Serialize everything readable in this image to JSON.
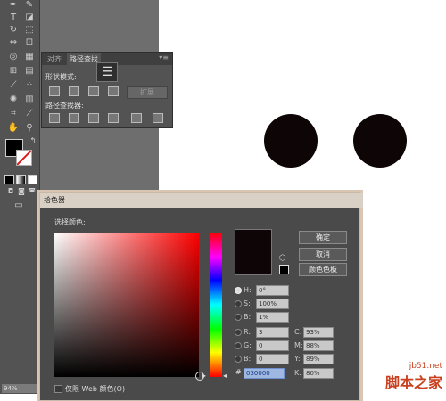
{
  "pathfinder": {
    "tabs": [
      "对齐",
      "路径查找"
    ],
    "shape_modes_label": "形状模式:",
    "pathfinders_label": "路径查找器:",
    "expand_label": "扩展",
    "menu_glyph": "☰"
  },
  "color_picker": {
    "title": "拾色器",
    "select_color_label": "选择颜色:",
    "ok_label": "确定",
    "cancel_label": "取消",
    "swatches_label": "颜色色板",
    "hsb": [
      {
        "label": "H:",
        "value": "0°",
        "selected": true
      },
      {
        "label": "S:",
        "value": "100%",
        "selected": false
      },
      {
        "label": "B:",
        "value": "1%",
        "selected": false
      }
    ],
    "rgb": [
      {
        "label": "R:",
        "value": "3"
      },
      {
        "label": "G:",
        "value": "0"
      },
      {
        "label": "B:",
        "value": "0"
      }
    ],
    "cmyk": [
      {
        "label": "C:",
        "value": "93%"
      },
      {
        "label": "M:",
        "value": "88%"
      },
      {
        "label": "Y:",
        "value": "89%"
      },
      {
        "label": "K:",
        "value": "80%"
      }
    ],
    "hex_label": "#",
    "hex_value": "030000",
    "web_only_label": "仅限 Web 颜色(O)",
    "preview_color": "#0d0506"
  },
  "zoom": {
    "value": "94%"
  },
  "watermark": {
    "line1": "jb51.net",
    "line2": "脚本之家"
  }
}
